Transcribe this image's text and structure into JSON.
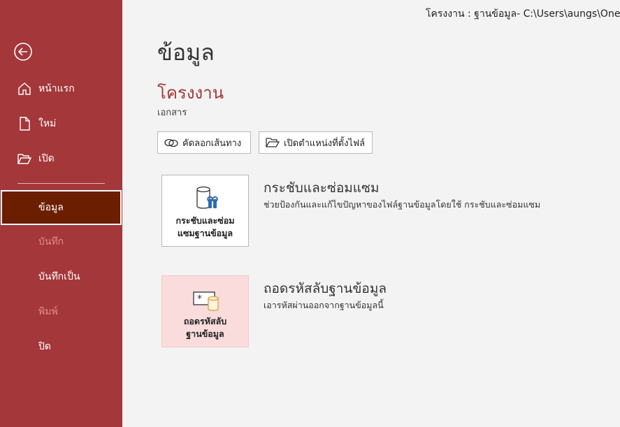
{
  "window": {
    "path_title": "โครงงาน : ฐานข้อมูล- C:\\Users\\aungs\\OneDrive"
  },
  "sidebar": {
    "back": {
      "icon": "back-arrow-icon"
    },
    "items": [
      {
        "label": "หน้าแรก",
        "icon": "home-icon"
      },
      {
        "label": "ใหม่",
        "icon": "new-document-icon"
      },
      {
        "label": "เปิด",
        "icon": "open-folder-icon"
      },
      {
        "label": "ข้อมูล",
        "selected": true
      },
      {
        "label": "บันทึก",
        "disabled": true
      },
      {
        "label": "บันทึกเป็น"
      },
      {
        "label": "พิมพ์",
        "disabled": true
      },
      {
        "label": "ปิด"
      }
    ]
  },
  "main": {
    "page_title": "ข้อมูล",
    "project_name": "โครงงาน",
    "project_sub": "เอกสาร",
    "buttons": {
      "copy_path": "คัดลอกเส้นทาง",
      "open_location": "เปิดตำแหน่งที่ตั้งไฟล์"
    },
    "compact": {
      "tile_line1": "กระชับและซ่อม",
      "tile_line2": "แซมฐานข้อมูล",
      "title": "กระชับและซ่อมแซม",
      "description": "ช่วยป้องกันและแก้ไขปัญหาของไฟล์ฐานข้อมูลโดยใช้ กระชับและซ่อมแซม"
    },
    "decrypt": {
      "tile_line1": "ถอดรหัสลับ",
      "tile_line2": "ฐานข้อมูล",
      "title": "ถอดรหัสลับฐานข้อมูล",
      "description": "เอารหัสผ่านออกจากฐานข้อมูลนี้"
    }
  },
  "colors": {
    "sidebar": "#a4373a",
    "selected": "#6b1e00",
    "accent_text": "#a4373a",
    "tile_pink": "#fadcdc"
  }
}
